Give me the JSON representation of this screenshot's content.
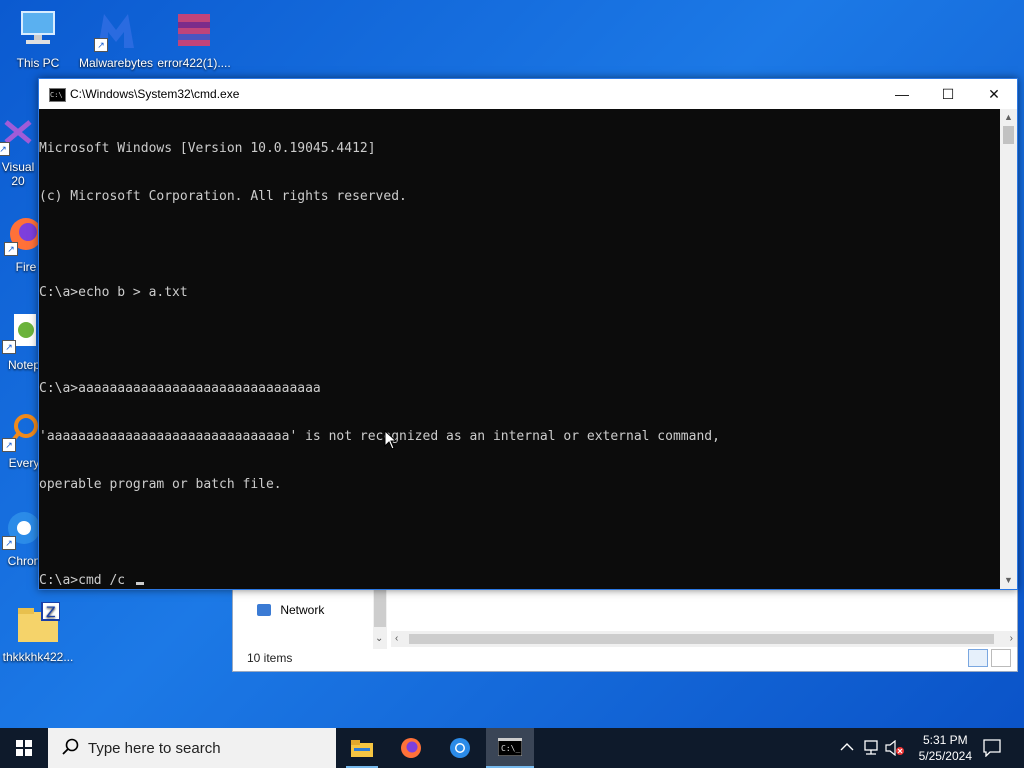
{
  "desktop": {
    "icons": [
      {
        "label": "This PC",
        "icon": "computer-icon"
      },
      {
        "label": "Malwarebytes",
        "icon": "malwarebytes-icon"
      },
      {
        "label": "error422(1)....",
        "icon": "archive-icon"
      },
      {
        "label": "Visual\n20",
        "icon": "visual-studio-icon"
      },
      {
        "label": "Fire",
        "icon": "firefox-icon"
      },
      {
        "label": "Notep",
        "icon": "notepad-icon"
      },
      {
        "label": "Every",
        "icon": "everything-icon"
      },
      {
        "label": "Chron",
        "icon": "chrome-icon"
      },
      {
        "label": "thkkkhk422...",
        "icon": "zip-folder-icon"
      }
    ]
  },
  "explorer": {
    "nav_item": "Network",
    "status": "10 items"
  },
  "cmd": {
    "title": "C:\\Windows\\System32\\cmd.exe",
    "lines": [
      "Microsoft Windows [Version 10.0.19045.4412]",
      "(c) Microsoft Corporation. All rights reserved.",
      "",
      "C:\\a>echo b > a.txt",
      "",
      "C:\\a>aaaaaaaaaaaaaaaaaaaaaaaaaaaaaaa",
      "'aaaaaaaaaaaaaaaaaaaaaaaaaaaaaaa' is not recognized as an internal or external command,",
      "operable program or batch file.",
      "",
      "C:\\a>cmd /c "
    ],
    "controls": {
      "minimize": "—",
      "maximize": "☐",
      "close": "✕"
    }
  },
  "taskbar": {
    "search_placeholder": "Type here to search",
    "apps": [
      "file-explorer-icon",
      "firefox-icon",
      "chrome-icon",
      "cmd-icon"
    ],
    "clock_time": "5:31 PM",
    "clock_date": "5/25/2024"
  },
  "colors": {
    "desktop": "#1c79e6",
    "console_bg": "#0c0c0c",
    "console_fg": "#cccccc",
    "taskbar": "#0e1a2b"
  }
}
